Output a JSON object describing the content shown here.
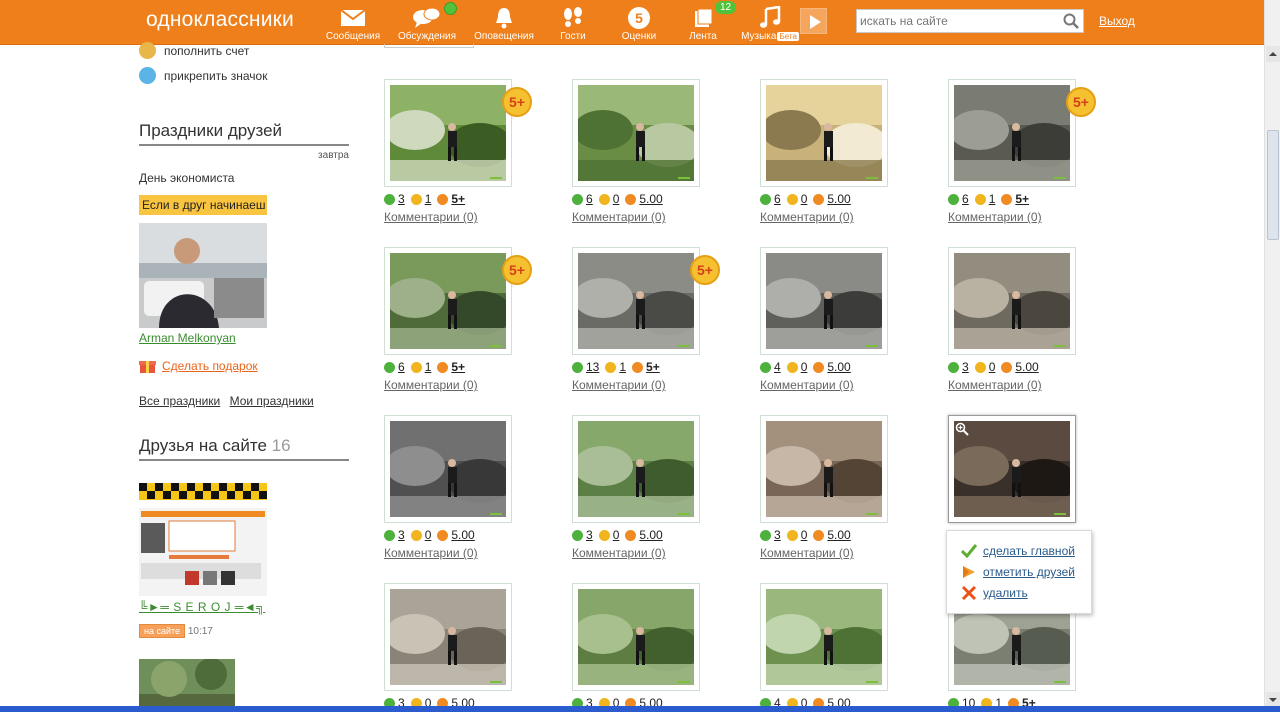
{
  "header": {
    "logo": "одноклассники",
    "nav": [
      {
        "label": "Сообщения",
        "icon": "envelope-icon"
      },
      {
        "label": "Обсуждения",
        "icon": "chat-bubbles-icon"
      },
      {
        "label": "Оповещения",
        "icon": "bell-icon"
      },
      {
        "label": "Гости",
        "icon": "footprints-icon"
      },
      {
        "label": "Оценки",
        "icon": "five-circle-icon",
        "icon_text": "5"
      },
      {
        "label": "Лента",
        "icon": "feed-icon",
        "badge": "12"
      },
      {
        "label": "Музыка",
        "icon": "music-note-icon",
        "tag": "Бета"
      }
    ],
    "search_placeholder": "искать на сайте",
    "exit": "Выход"
  },
  "left": {
    "actions": [
      "пополнить счет",
      "прикрепить значок"
    ],
    "holidays": {
      "title": "Праздники друзей",
      "when": "завтра",
      "holiday_name": "День экономиста",
      "status_text": "Если в друг начинаеш",
      "friend_name": "Arman Melkonyan",
      "gift_link": "Сделать подарок",
      "all_link": "Все праздники",
      "my_link": "Мои праздники"
    },
    "friends": {
      "title": "Друзья на сайте",
      "count": "16",
      "friend1_name": "╚►═ S E R O J ═◄╗",
      "badge": "на сайте",
      "time": "10:17"
    }
  },
  "photos": [
    {
      "a": "3",
      "b": "1",
      "c": "5+",
      "badge": true
    },
    {
      "a": "6",
      "b": "0",
      "c": "5.00",
      "badge": false
    },
    {
      "a": "6",
      "b": "0",
      "c": "5.00",
      "badge": false
    },
    {
      "a": "6",
      "b": "1",
      "c": "5+",
      "badge": true
    },
    {
      "a": "6",
      "b": "1",
      "c": "5+",
      "badge": true
    },
    {
      "a": "13",
      "b": "1",
      "c": "5+",
      "badge": true
    },
    {
      "a": "4",
      "b": "0",
      "c": "5.00",
      "badge": false
    },
    {
      "a": "3",
      "b": "0",
      "c": "5.00",
      "badge": false
    },
    {
      "a": "3",
      "b": "0",
      "c": "5.00",
      "badge": false
    },
    {
      "a": "3",
      "b": "0",
      "c": "5.00",
      "badge": false
    },
    {
      "a": "3",
      "b": "0",
      "c": "5.00",
      "badge": false
    },
    {
      "a": "",
      "b": "",
      "c": "",
      "badge": false
    },
    {
      "a": "3",
      "b": "0",
      "c": "5.00",
      "badge": false
    },
    {
      "a": "3",
      "b": "0",
      "c": "5.00",
      "badge": false
    },
    {
      "a": "4",
      "b": "0",
      "c": "5.00",
      "badge": false
    },
    {
      "a": "10",
      "b": "1",
      "c": "5+",
      "badge": true
    }
  ],
  "comments_label": "Комментарии (0)",
  "badge_text": "5+",
  "popup": {
    "make_main": "сделать главной",
    "tag_friends": "отметить друзей",
    "delete": "удалить"
  }
}
